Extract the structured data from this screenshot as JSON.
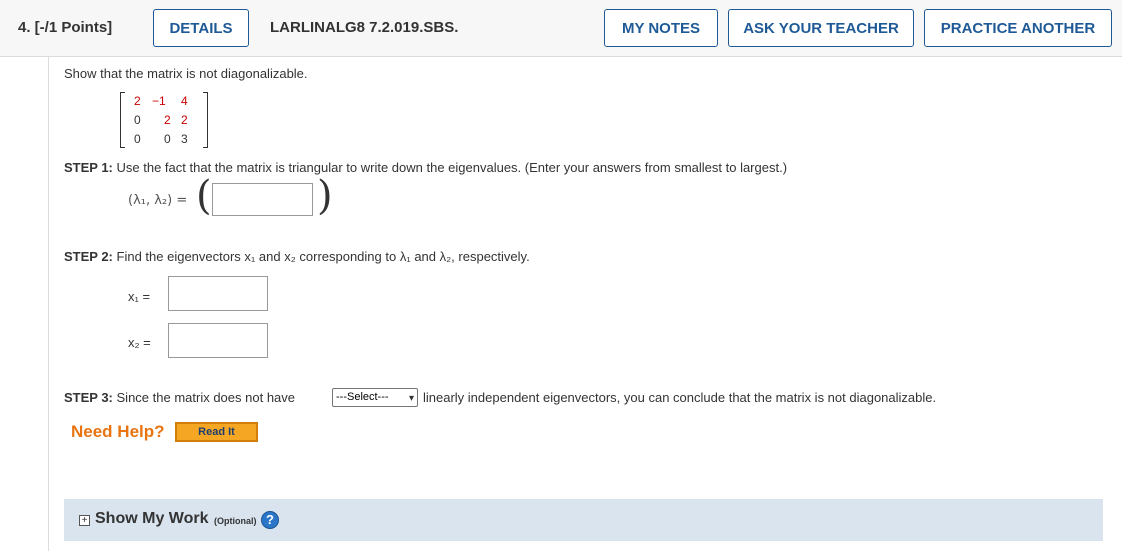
{
  "header": {
    "question_number": "4. [-/1 Points]",
    "details_label": "DETAILS",
    "question_id": "LARLINALG8 7.2.019.SBS.",
    "my_notes_label": "MY NOTES",
    "ask_teacher_label": "ASK YOUR TEACHER",
    "practice_another_label": "PRACTICE ANOTHER"
  },
  "prompt": "Show that the matrix is not diagonalizable.",
  "matrix": {
    "rows": [
      [
        "2",
        "−1",
        "4"
      ],
      [
        "0",
        "2",
        "2"
      ],
      [
        "0",
        "0",
        "3"
      ]
    ]
  },
  "step1": {
    "label": "STEP 1:",
    "text": "Use the fact that the matrix is triangular to write down the eigenvalues. (Enter your answers from smallest to largest.)",
    "eigen_label": "(λ₁, λ₂) =",
    "answer_value": ""
  },
  "step2": {
    "label": "STEP 2:",
    "text": "Find the eigenvectors x₁ and x₂ corresponding to λ₁ and λ₂, respectively.",
    "x1_label": "x₁ =",
    "x2_label": "x₂ =",
    "x1_value": "",
    "x2_value": ""
  },
  "step3": {
    "label": "STEP 3:",
    "text_before": "Since the matrix does not have",
    "select_value": "---Select---",
    "text_after": "linearly independent eigenvectors, you can conclude that the matrix is not diagonalizable."
  },
  "help": {
    "need_help": "Need Help?",
    "read_it": "Read It"
  },
  "show_my_work": {
    "toggle": "+",
    "title": "Show My Work",
    "optional": "(Optional)",
    "help_icon": "?"
  },
  "colors": {
    "accent_blue": "#1f5a96",
    "need_help_orange": "#e87511",
    "read_it_bg": "#f5a623",
    "matrix_red": "#cc0000",
    "show_work_bg": "#d9e4ef"
  }
}
